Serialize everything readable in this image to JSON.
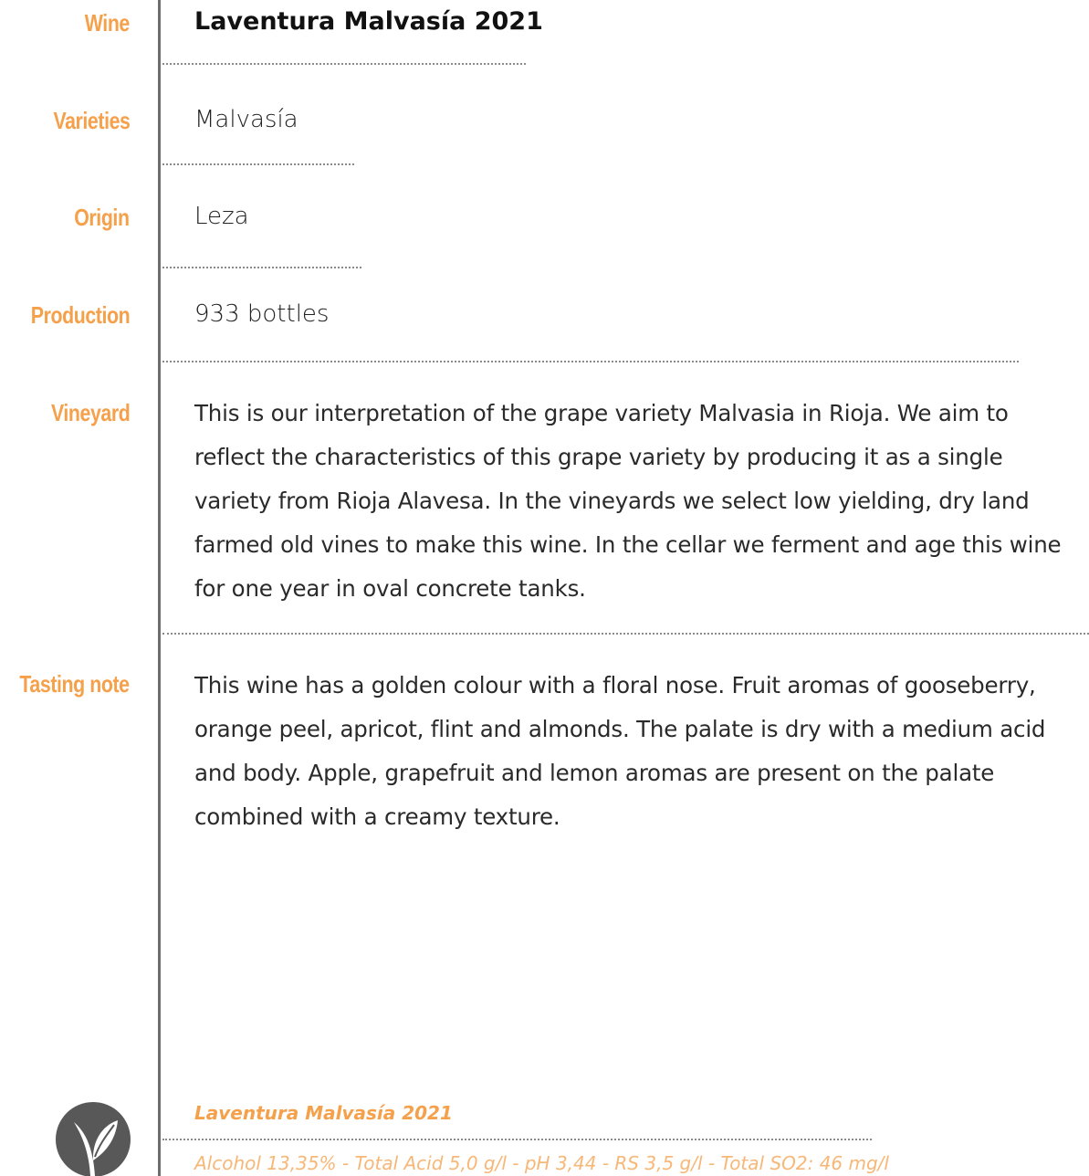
{
  "labels": {
    "wine": "Wine",
    "varieties": "Varieties",
    "origin": "Origin",
    "production": "Production",
    "vineyard": "Vineyard",
    "tasting_note": "Tasting note"
  },
  "values": {
    "wine": "Laventura Malvasía 2021",
    "varieties": "Malvasía",
    "origin": "Leza",
    "production": "933 bottles",
    "vineyard": "This is our interpretation of the grape variety Malvasia in Rioja. We aim to reflect the characteristics of this grape variety by producing it as a single variety from Rioja Alavesa. In the vineyards we select low yielding, dry land farmed old vines to make this wine. In the cellar we ferment and age this wine for one year in oval concrete tanks.",
    "tasting_note": "This wine has a golden colour with a floral nose. Fruit aromas of gooseberry, orange peel, apricot, flint and almonds. The palate is dry with a medium acid and body. Apple, grapefruit and lemon aromas are present on the palate combined with a creamy texture."
  },
  "footer": {
    "name": "Laventura Malvasía 2021",
    "specs": "Alcohol 13,35% - Total Acid 5,0 g/l - pH 3,44 - RS 3,5 g/l - Total SO2: 46 mg/l"
  },
  "icons": {
    "logo": "leaf-sprout-icon"
  },
  "colors": {
    "accent": "#f5a04a",
    "footer_specs": "#f7b777",
    "rule": "#6d6d6d",
    "logo": "#585858"
  }
}
